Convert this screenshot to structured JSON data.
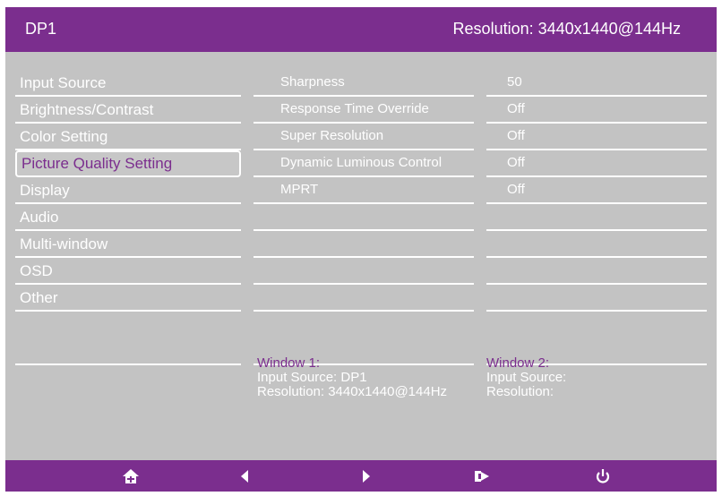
{
  "header": {
    "input": "DP1",
    "resolution": "Resolution: 3440x1440@144Hz"
  },
  "menu": {
    "items": [
      {
        "label": "Input Source"
      },
      {
        "label": "Brightness/Contrast"
      },
      {
        "label": "Color Setting"
      },
      {
        "label": "Picture Quality Setting",
        "selected": true
      },
      {
        "label": "Display"
      },
      {
        "label": "Audio"
      },
      {
        "label": "Multi-window"
      },
      {
        "label": "OSD"
      },
      {
        "label": "Other"
      }
    ]
  },
  "settings": [
    {
      "name": "Sharpness",
      "value": "50"
    },
    {
      "name": "Response Time Override",
      "value": "Off"
    },
    {
      "name": "Super Resolution",
      "value": "Off"
    },
    {
      "name": "Dynamic Luminous Control",
      "value": "Off"
    },
    {
      "name": "MPRT",
      "value": "Off"
    }
  ],
  "windows": [
    {
      "title": "Window 1:",
      "input": "Input Source: DP1",
      "resolution": "Resolution: 3440x1440@144Hz"
    },
    {
      "title": "Window 2:",
      "input": "Input Source:",
      "resolution": "Resolution:"
    }
  ],
  "footer": {
    "buttons": [
      "home-icon",
      "left-arrow-icon",
      "right-arrow-icon",
      "exit-icon",
      "power-icon"
    ]
  },
  "colors": {
    "accent": "#7b2e8e",
    "panel": "#c3c3c3",
    "text": "#ffffff"
  }
}
